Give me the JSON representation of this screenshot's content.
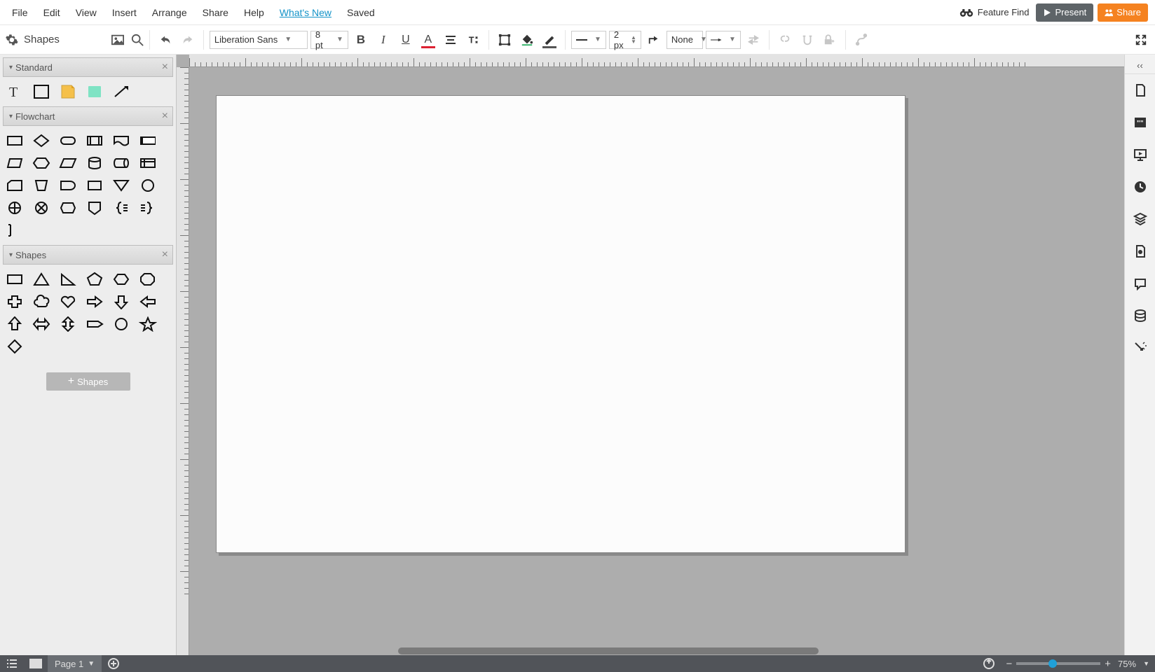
{
  "menu": {
    "items": [
      "File",
      "Edit",
      "View",
      "Insert",
      "Arrange",
      "Share",
      "Help"
    ],
    "whatsnew": "What's New",
    "saved": "Saved",
    "featurefind": "Feature Find",
    "present": "Present",
    "share": "Share"
  },
  "shapesPanel": {
    "title": "Shapes",
    "addShapes": "Shapes"
  },
  "categories": [
    {
      "name": "Standard",
      "shapes": [
        "text",
        "rect",
        "note",
        "hotspot",
        "line"
      ]
    },
    {
      "name": "Flowchart",
      "shapes": [
        "process",
        "decision",
        "terminator",
        "predef",
        "document",
        "swimh",
        "data-io",
        "preparation",
        "data-skew",
        "database",
        "direct",
        "intstorage",
        "punch",
        "manual-in",
        "delay",
        "display",
        "merge",
        "connector",
        "sum",
        "or",
        "collate",
        "offpage",
        "brace-l",
        "brace-r",
        "note2"
      ]
    },
    {
      "name": "Shapes",
      "shapes": [
        "rect2",
        "triangle",
        "right-tri",
        "pentagon2",
        "hexagon2",
        "octagon",
        "cross",
        "cloud",
        "heart",
        "arrow-r",
        "arrow-d",
        "arrow-l",
        "arrow-u",
        "arrow-lr",
        "arrow-ud",
        "arrow-sign",
        "circle",
        "star5",
        "diamond2"
      ]
    }
  ],
  "toolbar": {
    "font": "Liberation Sans",
    "fontsize": "8 pt",
    "linewidth": "2 px",
    "linestart": "None"
  },
  "status": {
    "page": "Page 1",
    "zoom": "75%"
  },
  "rightDock": [
    "collapse",
    "page",
    "comments-quotes",
    "slideshow",
    "history",
    "layers",
    "themes",
    "comments",
    "data",
    "actions"
  ]
}
